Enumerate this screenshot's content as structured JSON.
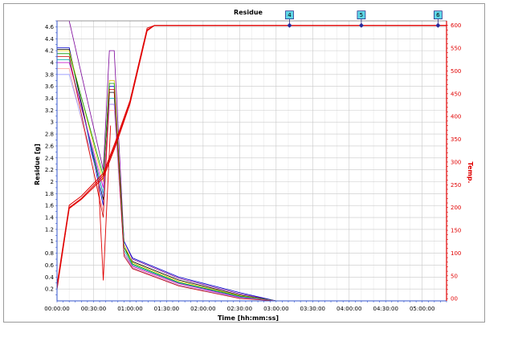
{
  "chart_data": {
    "type": "line",
    "title": "Residue",
    "xlabel": "Time [hh:mm:ss]",
    "ylabel": "Residue [g]",
    "y2label": "Temp.",
    "xlim": [
      0,
      320
    ],
    "ylim": [
      0,
      4.7
    ],
    "y2lim": [
      -5,
      610
    ],
    "grid": true,
    "x_tick_values": [
      0,
      30,
      60,
      90,
      120,
      150,
      180,
      210,
      240,
      270,
      300
    ],
    "x_tick_labels": [
      "00:00:00",
      "00:30:00",
      "01:00:00",
      "01:30:00",
      "02:00:00",
      "02:30:00",
      "03:00:00",
      "03:30:00",
      "04:00:00",
      "04:30:00",
      "05:00:00"
    ],
    "y_tick_values": [
      0.2,
      0.4,
      0.6,
      0.8,
      1,
      1.2,
      1.4,
      1.6,
      1.8,
      2,
      2.2,
      2.4,
      2.6,
      2.8,
      3,
      3.2,
      3.4,
      3.6,
      3.8,
      4,
      4.2,
      4.4,
      4.6
    ],
    "y_tick_labels": [
      "0.2",
      "0.4",
      "0.6",
      "0.8",
      "1",
      "1.2",
      "1.4",
      "1.6",
      "1.8",
      "2",
      "2.2",
      "2.4",
      "2.6",
      "2.8",
      "3",
      "3.2",
      "3.4",
      "3.6",
      "3.8",
      "4",
      "4.2",
      "4.4",
      "4.6"
    ],
    "y2_tick_values": [
      0,
      50,
      100,
      150,
      200,
      250,
      300,
      350,
      400,
      450,
      500,
      550,
      600
    ],
    "y2_tick_labels": [
      "00",
      "50",
      "100",
      "150",
      "200",
      "250",
      "300",
      "350",
      "400",
      "450",
      "500",
      "550",
      "600"
    ],
    "residue_series": [
      {
        "color": "#7a0099",
        "x": [
          0,
          10,
          38,
          43,
          47,
          55,
          62,
          100,
          150,
          180
        ],
        "y": [
          4.7,
          4.7,
          2.2,
          4.2,
          4.2,
          1.0,
          0.7,
          0.38,
          0.12,
          0.0
        ]
      },
      {
        "color": "#0000cc",
        "x": [
          0,
          10,
          38,
          43,
          47,
          55,
          62,
          100,
          150,
          180
        ],
        "y": [
          4.25,
          4.25,
          1.6,
          3.6,
          3.6,
          1.0,
          0.72,
          0.4,
          0.14,
          0.0
        ]
      },
      {
        "color": "#000000",
        "x": [
          0,
          10,
          38,
          43,
          47,
          55,
          62,
          100,
          150,
          180
        ],
        "y": [
          4.22,
          4.22,
          1.7,
          3.5,
          3.5,
          0.9,
          0.66,
          0.35,
          0.1,
          0.0
        ]
      },
      {
        "color": "#e0c000",
        "x": [
          0,
          10,
          38,
          43,
          47,
          55,
          62,
          100,
          150,
          180
        ],
        "y": [
          4.2,
          4.2,
          2.0,
          3.7,
          3.7,
          0.95,
          0.64,
          0.33,
          0.09,
          0.0
        ]
      },
      {
        "color": "#009900",
        "x": [
          0,
          10,
          38,
          43,
          47,
          55,
          62,
          100,
          150,
          180
        ],
        "y": [
          4.15,
          4.15,
          2.1,
          3.65,
          3.65,
          0.9,
          0.62,
          0.31,
          0.08,
          0.0
        ]
      },
      {
        "color": "#00aaaa",
        "x": [
          0,
          10,
          38,
          43,
          47,
          55,
          62,
          100,
          150,
          180
        ],
        "y": [
          4.05,
          4.05,
          1.8,
          3.4,
          3.4,
          0.85,
          0.6,
          0.3,
          0.07,
          0.0
        ]
      },
      {
        "color": "#cc00cc",
        "x": [
          0,
          10,
          38,
          43,
          47,
          55,
          62,
          100,
          150,
          180
        ],
        "y": [
          4.0,
          4.0,
          1.9,
          3.3,
          3.3,
          0.8,
          0.58,
          0.29,
          0.06,
          0.0
        ]
      },
      {
        "color": "#ff9999",
        "x": [
          0,
          10,
          38,
          43,
          47,
          55,
          62,
          100,
          150,
          180
        ],
        "y": [
          3.9,
          3.9,
          1.5,
          3.2,
          3.2,
          0.8,
          0.56,
          0.27,
          0.05,
          0.0
        ]
      },
      {
        "color": "#9999ff",
        "x": [
          0,
          10,
          38,
          43,
          47,
          55,
          62,
          100,
          150,
          180
        ],
        "y": [
          3.8,
          3.8,
          1.75,
          3.3,
          3.3,
          0.78,
          0.55,
          0.26,
          0.05,
          0.0
        ]
      },
      {
        "color": "#cc0000",
        "x": [
          0,
          10,
          38,
          43,
          47,
          55,
          62,
          100,
          150,
          180
        ],
        "y": [
          4.1,
          4.1,
          1.4,
          3.55,
          3.55,
          0.75,
          0.54,
          0.25,
          0.04,
          0.0
        ]
      }
    ],
    "temperature_series": [
      {
        "color": "#e00000",
        "x": [
          0,
          10,
          20,
          38,
          48,
          60,
          74,
          80,
          320
        ],
        "y": [
          20,
          200,
          220,
          270,
          340,
          430,
          590,
          600,
          600
        ]
      },
      {
        "color": "#e00000",
        "x": [
          0,
          10,
          20,
          38,
          48,
          60,
          74,
          80,
          320
        ],
        "y": [
          30,
          205,
          225,
          275,
          345,
          435,
          594,
          600,
          600
        ]
      },
      {
        "color": "#e00000",
        "x": [
          0,
          10,
          20,
          38,
          48,
          60,
          74,
          80,
          320
        ],
        "y": [
          25,
          198,
          218,
          265,
          335,
          428,
          588,
          600,
          600
        ]
      }
    ],
    "temperature_spike": {
      "color": "#e00000",
      "x": [
        34,
        38,
        44
      ],
      "y": [
        260,
        40,
        380
      ]
    },
    "markers": [
      {
        "label": "4",
        "x": 191,
        "y2": 600
      },
      {
        "label": "5",
        "x": 250,
        "y2": 600
      },
      {
        "label": "6",
        "x": 313,
        "y2": 600
      }
    ]
  }
}
